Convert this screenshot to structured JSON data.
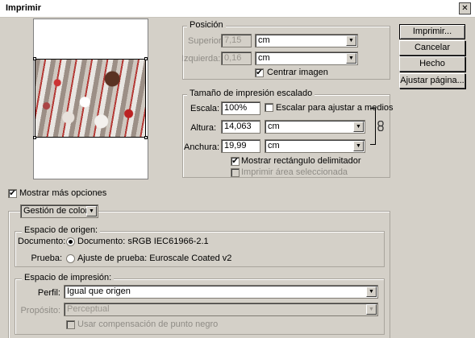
{
  "window": {
    "title": "Imprimir",
    "close_glyph": "✕"
  },
  "buttons": {
    "print": "Imprimir...",
    "cancel": "Cancelar",
    "done": "Hecho",
    "page_setup": "Ajustar página..."
  },
  "position": {
    "legend": "Posición",
    "top_label": "Superior:",
    "top_value": "7,15",
    "top_unit": "cm",
    "left_label": "Izquierda:",
    "left_value": "0,16",
    "left_unit": "cm",
    "center_label": "Centrar imagen",
    "center_checked": true
  },
  "scaled": {
    "legend": "Tamaño de impresión escalado",
    "scale_label": "Escala:",
    "scale_value": "100%",
    "fit_label": "Escalar para ajustar a medios",
    "fit_checked": false,
    "height_label": "Altura:",
    "height_value": "14,063",
    "height_unit": "cm",
    "width_label": "Anchura:",
    "width_value": "19,99",
    "width_unit": "cm",
    "bbox_label": "Mostrar rectángulo delimitador",
    "bbox_checked": true,
    "print_sel_label": "Imprimir área seleccionada",
    "print_sel_checked": false,
    "link_icon": "chain-link-icon"
  },
  "more_options": {
    "label": "Mostrar más opciones",
    "checked": true,
    "dropdown": "Gestión de color"
  },
  "source": {
    "legend": "Espacio de origen:",
    "doc_label": "Documento:",
    "doc_option": "Documento: sRGB IEC61966-2.1",
    "proof_label": "Prueba:",
    "proof_option": "Ajuste de prueba: Euroscale Coated v2",
    "selected": "document"
  },
  "print_space": {
    "legend": "Espacio de impresión:",
    "profile_label": "Perfil:",
    "profile_value": "Igual que origen",
    "intent_label": "Propósito:",
    "intent_value": "Perceptual",
    "bpc_label": "Usar compensación de punto negro",
    "bpc_checked": false
  },
  "check_mark": "✔",
  "dropdown_arrow": "▼"
}
